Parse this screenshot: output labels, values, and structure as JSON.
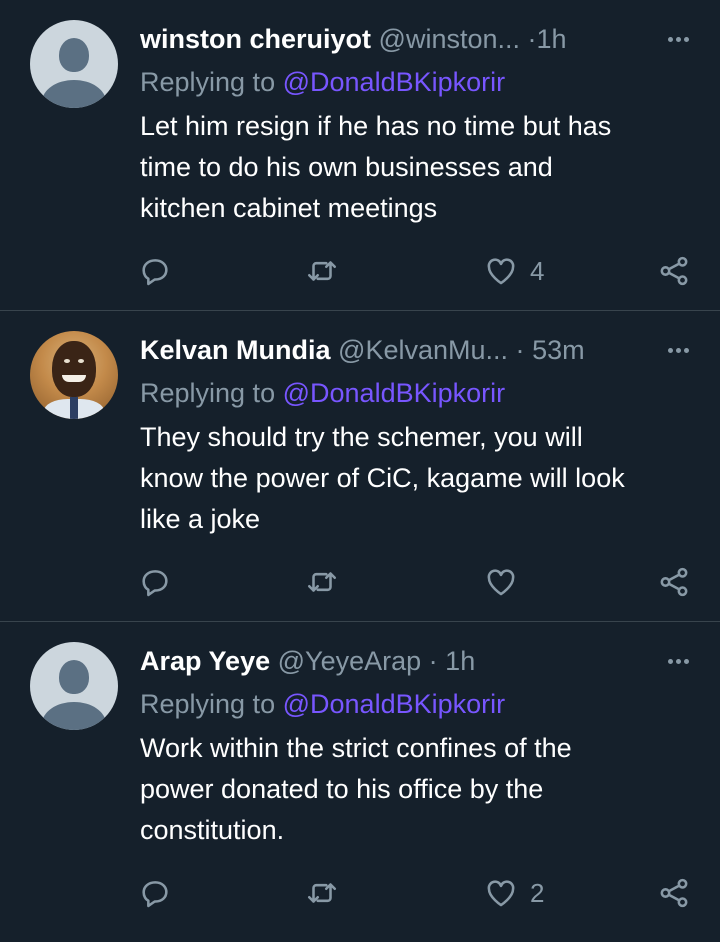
{
  "tweets": [
    {
      "author_name": "winston cheruiyot",
      "handle": "@winston...",
      "separator": "·",
      "time": "1h",
      "replying_label": "Replying to",
      "replying_to": "@DonaldBKipkorir",
      "lines": [
        "Let him resign if he has no time but has",
        "time to do his own businesses  and",
        "kitchen cabinet meetings"
      ],
      "like_count": "4",
      "avatar": "default-avatar"
    },
    {
      "author_name": "Kelvan Mundia",
      "handle": "@KelvanMu...",
      "separator": "·",
      "time": "53m",
      "replying_label": "Replying to",
      "replying_to": "@DonaldBKipkorir",
      "lines": [
        "They should try the schemer, you will",
        "know the power of CiC, kagame will look",
        "like a joke"
      ],
      "like_count": "",
      "avatar": "photo-avatar"
    },
    {
      "author_name": "Arap Yeye",
      "handle": "@YeyeArap",
      "separator": "·",
      "time": "1h",
      "replying_label": "Replying to",
      "replying_to": "@DonaldBKipkorir",
      "lines": [
        "Work within the strict confines of the",
        "power donated to his office by the",
        "constitution."
      ],
      "like_count": "2",
      "avatar": "default-avatar"
    }
  ],
  "icons": {
    "reply": "reply-icon",
    "retweet": "retweet-icon",
    "like": "heart-icon",
    "share": "share-icon",
    "more": "more-options-icon"
  },
  "colors": {
    "background": "#15202b",
    "secondary_text": "#8899a6",
    "mention": "#7856ff",
    "divider": "#38444d"
  }
}
